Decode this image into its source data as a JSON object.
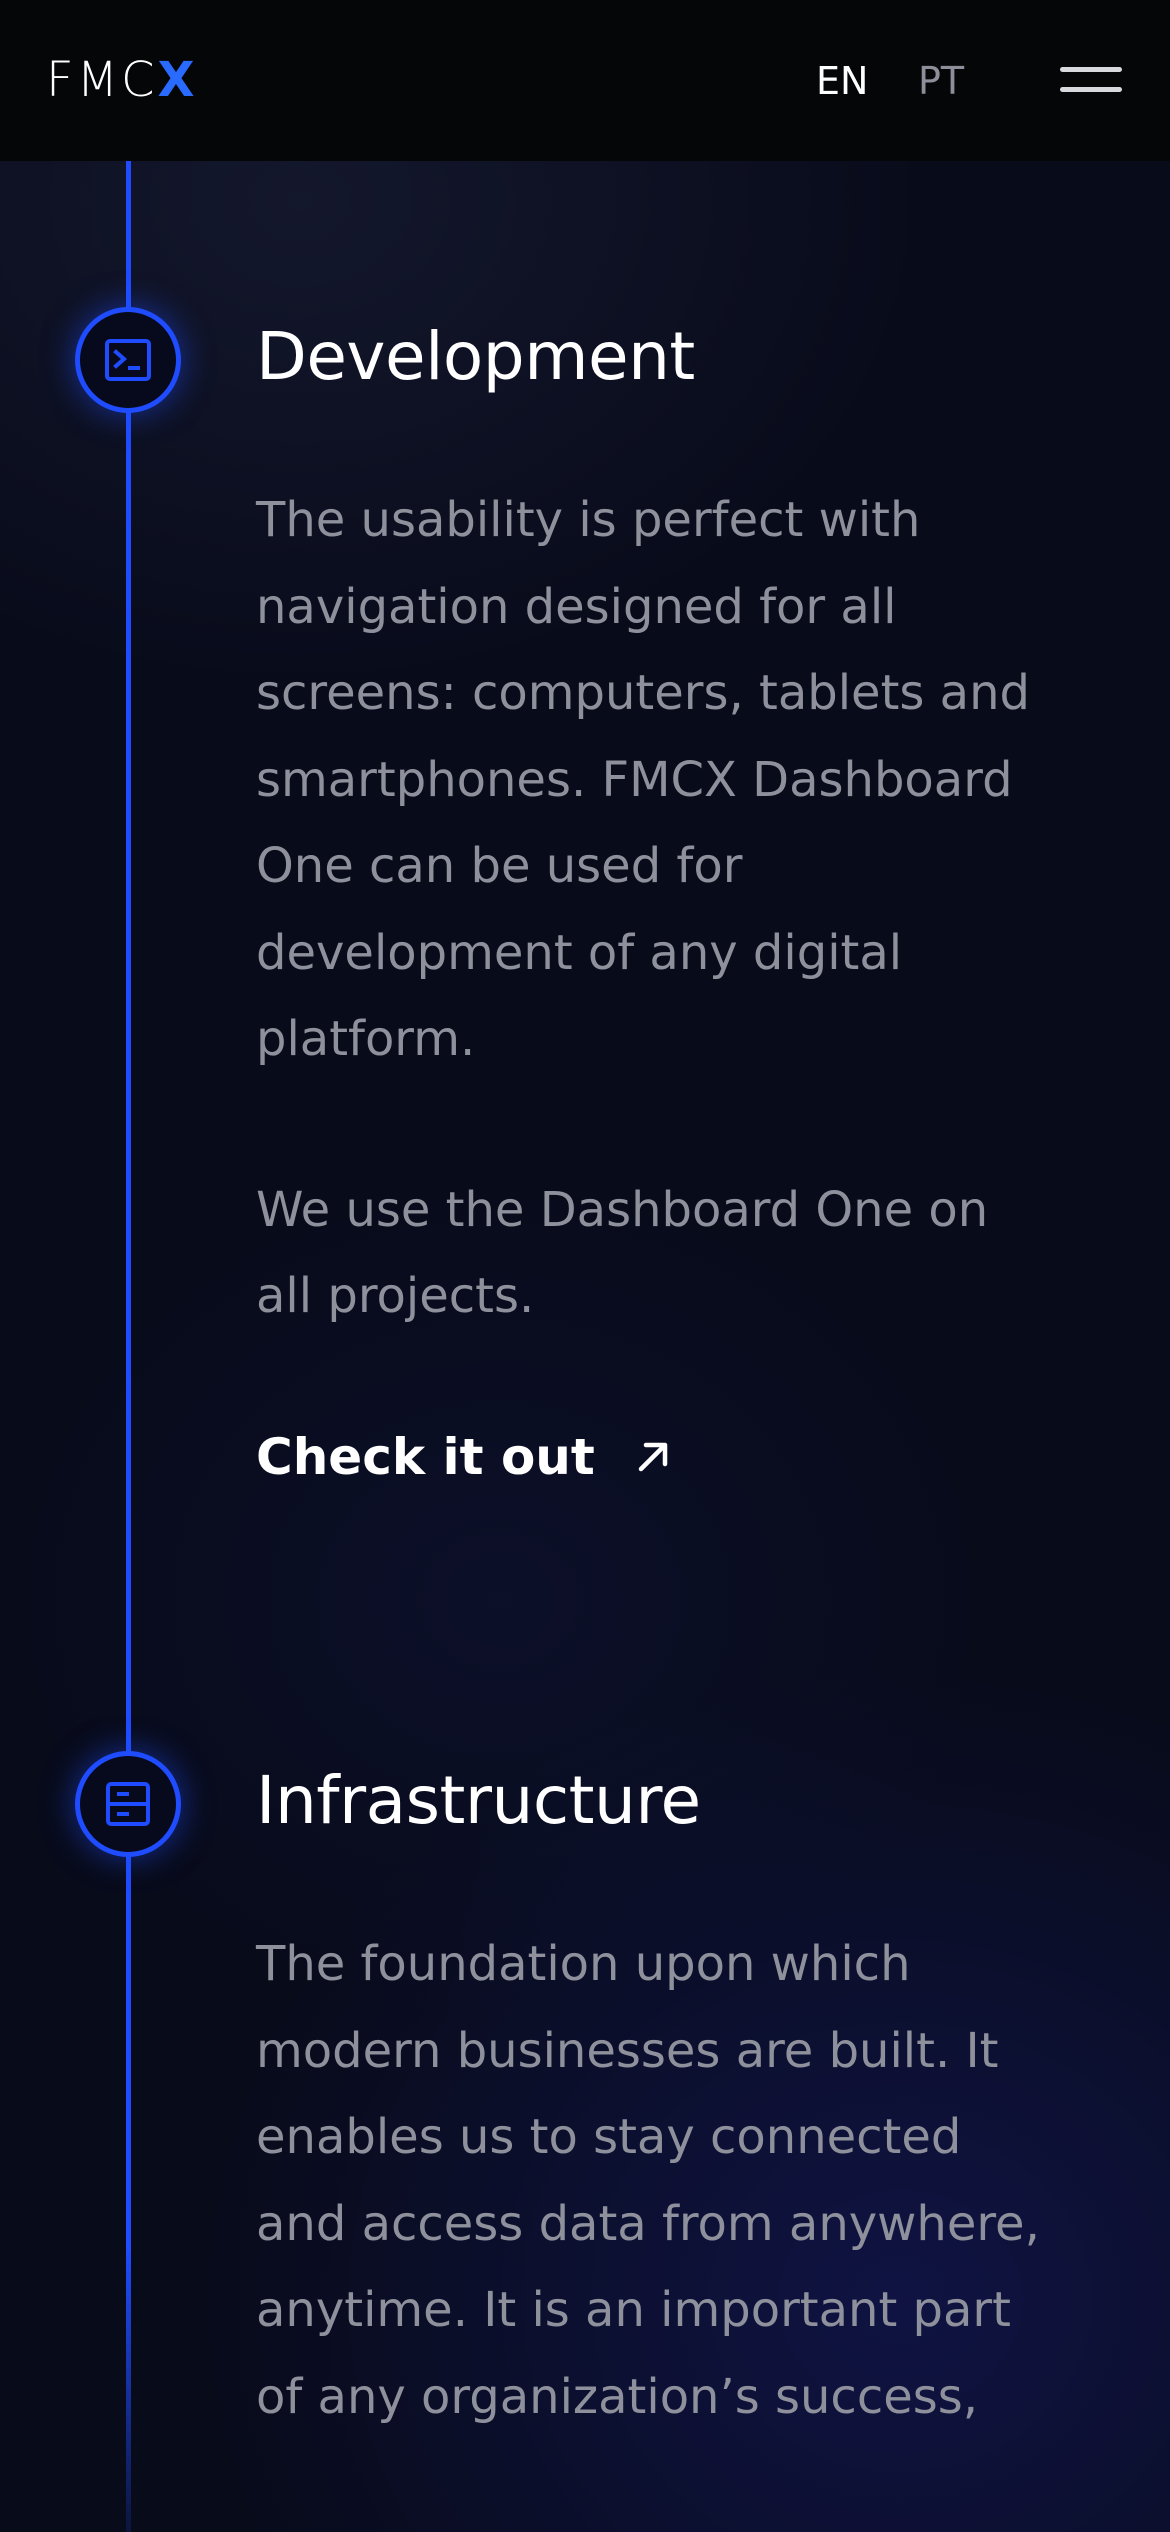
{
  "header": {
    "logo_text": "FMC",
    "logo_accent": "X",
    "languages": [
      "EN",
      "PT"
    ],
    "active_language": "EN",
    "menu_icon": "hamburger-icon"
  },
  "timeline": {
    "sections": [
      {
        "icon": "terminal-icon",
        "title": "Development",
        "paragraphs": [
          "The usability is perfect with navigation designed for all screens: computers, tablets and smartphones. FMCX Dashboard One can be used for development of any digital platform.",
          "We use the Dashboard One on all projects."
        ],
        "cta_label": "Check it out",
        "cta_icon": "arrow-up-right-icon"
      },
      {
        "icon": "server-icon",
        "title": "Infrastructure",
        "paragraphs": [
          "The foundation upon which modern businesses are built. It enables us to stay connected and access data from anywhere, anytime. It is an important part of any organization’s success,"
        ]
      }
    ]
  },
  "colors": {
    "accent": "#1f4cff",
    "logo_accent": "#2a6bff",
    "background": "#080b1a",
    "header_background": "#050608",
    "title_text": "#ffffff",
    "body_text": "#8e919c",
    "inactive_language": "#8c8f99"
  }
}
